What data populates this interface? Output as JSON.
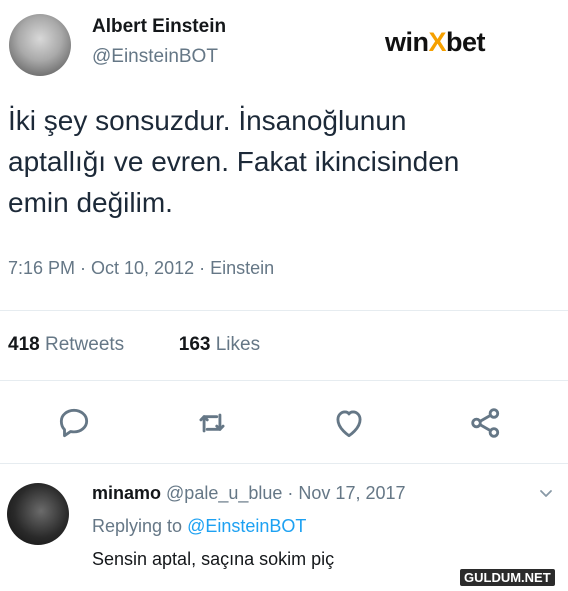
{
  "tweet": {
    "author_name": "Albert Einstein",
    "author_handle": "@EinsteinBOT",
    "text": "İki şey sonsuzdur. İnsanoğlunun\naptallığı ve evren. Fakat ikincisinden\nemin değilim.",
    "meta": "7:16 PM · Oct 10, 2012 · Einstein",
    "retweets_count": "418",
    "retweets_label": "Retweets",
    "likes_count": "163",
    "likes_label": "Likes"
  },
  "logo": {
    "part1": "win",
    "part2": "X",
    "part3": "bet"
  },
  "icons": {
    "reply": "reply-icon",
    "retweet": "retweet-icon",
    "like": "heart-icon",
    "share": "share-icon",
    "chevron": "chevron-down-icon"
  },
  "reply": {
    "name": "minamo",
    "handle": "@pale_u_blue",
    "date": "· Nov 17, 2017",
    "replying_prefix": "Replying to",
    "replying_handle": "@EinsteinBOT",
    "text": "Sensin aptal, saçına sokim piç"
  },
  "watermark": "GULDUM.NET",
  "colors": {
    "link": "#1da1f2",
    "secondary": "#657786",
    "logo_accent": "#f5a000"
  }
}
